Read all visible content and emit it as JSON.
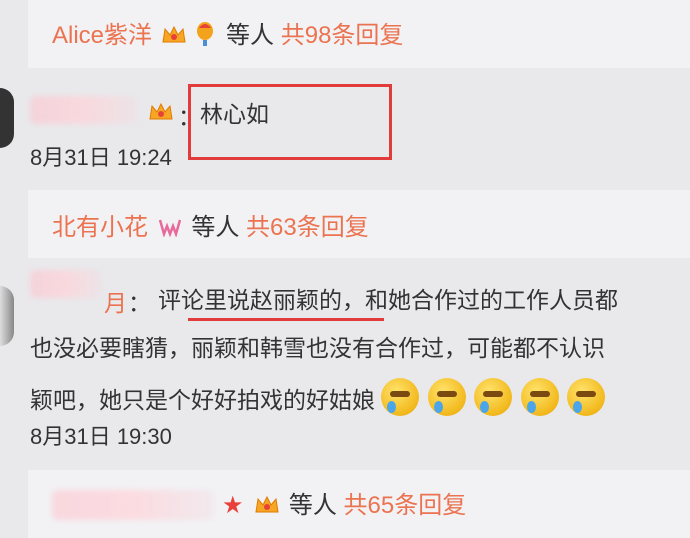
{
  "thread1": {
    "replier_name": "Alice紫洋",
    "others_label": "等人",
    "reply_count": "共98条回复"
  },
  "comment1": {
    "text": "林心如",
    "time": "8月31日 19:24"
  },
  "thread2": {
    "replier_name": "北有小花",
    "others_label": "等人",
    "reply_count": "共63条回复"
  },
  "comment2": {
    "name_visible": "月",
    "colon": "：",
    "line1": "评论里说赵丽颖的，和她合作过的工作人员都",
    "line2": "也没必要瞎猜，丽颖和韩雪也没有合作过，可能都不认识",
    "line3": "颖吧，她只是个好好拍戏的好姑娘",
    "time": "8月31日 19:30"
  },
  "thread3": {
    "others_label": "等人",
    "reply_count": "共65条回复"
  },
  "colors": {
    "accent": "#eb7350",
    "annotation": "#e23b3b"
  }
}
